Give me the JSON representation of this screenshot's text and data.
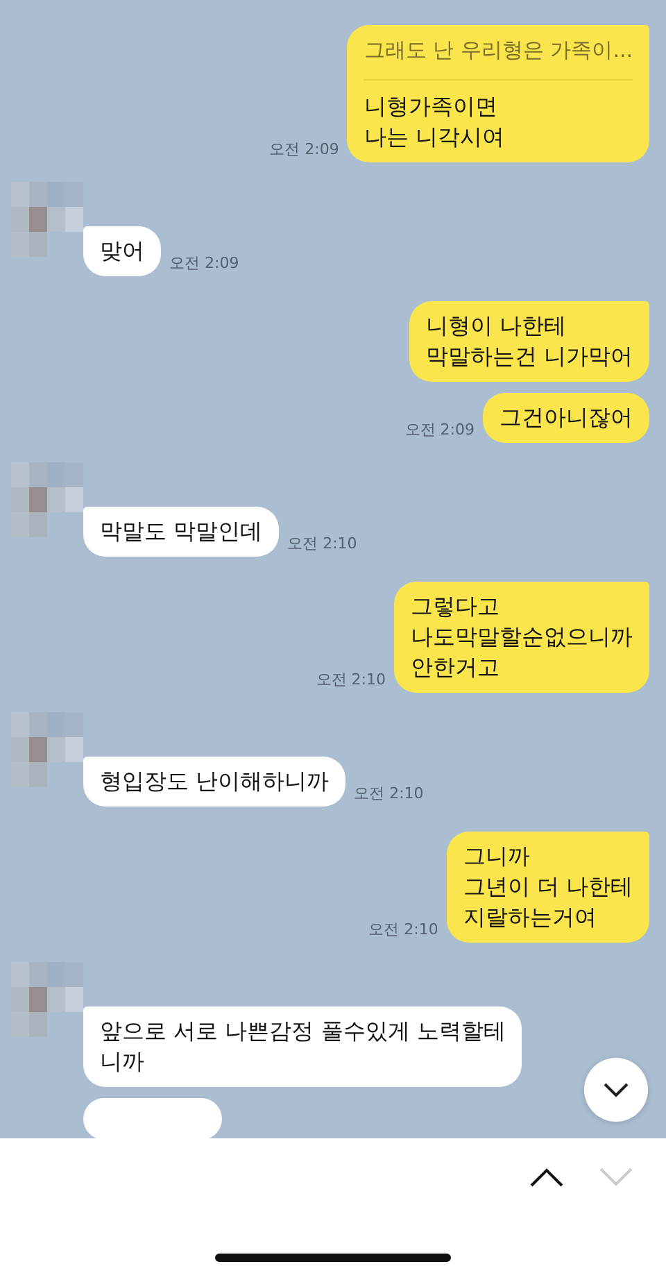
{
  "messages": [
    {
      "kind": "sent",
      "quote": "그래도 난 우리형은 가족이...",
      "text": "니형가족이면\n나는 니각시여",
      "time": "오전 2:09",
      "group_start": true
    },
    {
      "kind": "received",
      "text": "맞어",
      "time": "오전 2:09",
      "group_start": true
    },
    {
      "kind": "sent",
      "text": "니형이 나한테\n막말하는건 니가막어",
      "group_start": true
    },
    {
      "kind": "sent",
      "text": "그건아니잖어",
      "time": "오전 2:09",
      "group_start": false
    },
    {
      "kind": "received",
      "text": "막말도 막말인데",
      "time": "오전 2:10",
      "group_start": true
    },
    {
      "kind": "sent",
      "text": "그렇다고\n나도막말할순없으니까\n안한거고",
      "time": "오전 2:10",
      "group_start": true
    },
    {
      "kind": "received",
      "text": "형입장도 난이해하니까",
      "time": "오전 2:10",
      "group_start": true
    },
    {
      "kind": "sent",
      "text": "그니까\n그년이 더 나한테\n지랄하는거여",
      "time": "오전 2:10",
      "group_start": true
    },
    {
      "kind": "received",
      "text": "앞으로 서로 나쁜감정 풀수있게 노력할테\n니까",
      "group_start": true
    },
    {
      "kind": "received-cut",
      "group_start": false
    }
  ]
}
